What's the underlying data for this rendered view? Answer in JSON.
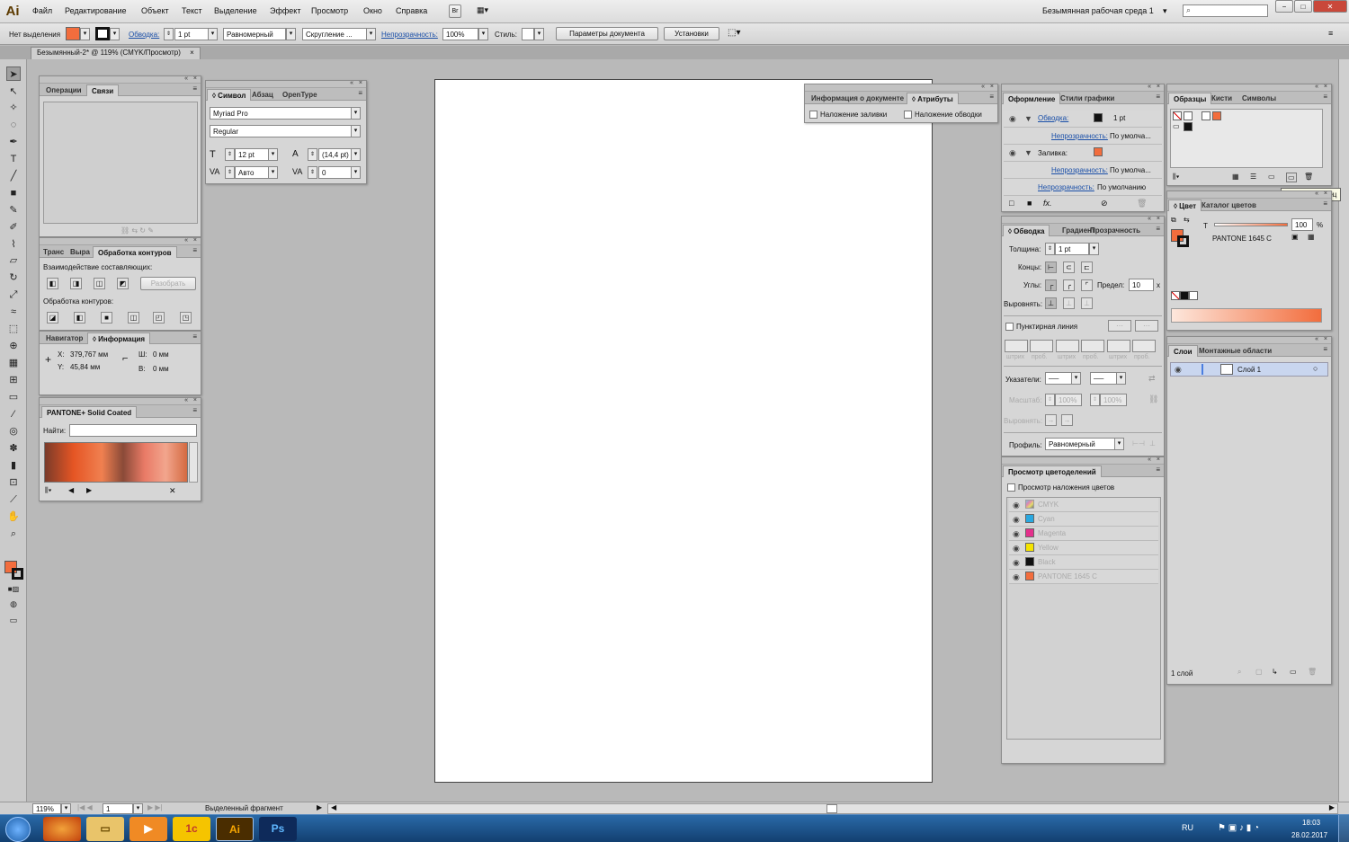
{
  "app": {
    "logo": "Ai",
    "workspace": "Безымянная рабочая среда 1",
    "workspace_arrow": "▾",
    "br": "Br",
    "layout_btn": "▦▾",
    "win_min": "−",
    "win_max": "□",
    "win_close": "✕"
  },
  "menu": [
    "Файл",
    "Редактирование",
    "Объект",
    "Текст",
    "Выделение",
    "Эффект",
    "Просмотр",
    "Окно",
    "Справка"
  ],
  "control": {
    "no_selection": "Нет выделения",
    "stroke_link": "Обводка:",
    "stroke_weight": "1 pt",
    "profile": "Равномерный",
    "brush": "Скругление ...",
    "opacity_link": "Непрозрачность:",
    "opacity": "100%",
    "style_label": "Стиль:",
    "doc_params": "Параметры документа",
    "prefs": "Установки"
  },
  "document_tab": {
    "title": "Безымянный-2* @ 119% (CMYK/Просмотр)",
    "close": "×"
  },
  "panels": {
    "links": {
      "tabs": [
        "Операции",
        "Связи"
      ]
    },
    "pathfinder": {
      "tabs": [
        "Транс",
        "Выра",
        "Обработка контуров"
      ],
      "shape_modes": "Взаимодействие составляющих:",
      "expand": "Разобрать",
      "pathfinders": "Обработка контуров:"
    },
    "info": {
      "tabs": [
        "Навигатор",
        "◊ Информация"
      ],
      "x_label": "X:",
      "x": "379,767 мм",
      "y_label": "Y:",
      "y": "45,84 мм",
      "w_label": "Ш:",
      "w": "0 мм",
      "h_label": "В:",
      "h": "0 мм"
    },
    "pantone": {
      "tab": "PANTONE+ Solid Coated",
      "find_label": "Найти:"
    },
    "character": {
      "tabs": [
        "◊ Символ",
        "Абзац",
        "OpenType"
      ],
      "font": "Myriad Pro",
      "style": "Regular",
      "size": "12 pt",
      "leading": "(14,4 pt)",
      "kerning": "Авто",
      "tracking": "0"
    },
    "docinfo": {
      "tabs": [
        "Информация о документе",
        "◊ Атрибуты"
      ],
      "overprint_fill": "Наложение заливки",
      "overprint_stroke": "Наложение обводки"
    },
    "appearance": {
      "tabs": [
        "Оформление",
        "Стили графики"
      ],
      "stroke_link": "Обводка:",
      "stroke_value": "1 pt",
      "opacity_link": "Непрозрачность:",
      "opacity_value": "По умолча...",
      "fill_label": "Заливка:",
      "opacity_link2": "Непрозрачность:",
      "opacity_value2": "По умолча...",
      "opacity_link3": "Непрозрачность:",
      "opacity_value3": "По умолчанию",
      "fx": "fx."
    },
    "stroke": {
      "tabs": [
        "◊ Обводка",
        "Градиент",
        "Прозрачность"
      ],
      "weight_label": "Толщина:",
      "weight": "1 pt",
      "cap_label": "Концы:",
      "corner_label": "Углы:",
      "limit_label": "Предел:",
      "limit": "10",
      "limit_unit": "x",
      "align_label": "Выровнять:",
      "dashed": "Пунктирная линия",
      "dash_labels": [
        "штрих",
        "проб.",
        "штрих",
        "проб.",
        "штрих",
        "проб."
      ],
      "arrows_label": "Указатели:",
      "scale_label": "Масштаб:",
      "scale1": "100%",
      "scale2": "100%",
      "align2_label": "Выровнять:",
      "profile_label": "Профиль:",
      "profile": "Равномерный"
    },
    "separations": {
      "tab": "Просмотр цветоделений",
      "overprint": "Просмотр наложения цветов",
      "inks": [
        "CMYK",
        "Cyan",
        "Magenta",
        "Yellow",
        "Black",
        "PANTONE 1645 C"
      ]
    },
    "swatches": {
      "tabs": [
        "Образцы",
        "Кисти",
        "Символы"
      ],
      "tooltip": "Новый образец"
    },
    "color": {
      "tabs": [
        "◊ Цвет",
        "Каталог цветов"
      ],
      "t_label": "T",
      "tint": "100",
      "tint_unit": "%",
      "name": "PANTONE 1645 C"
    },
    "layers": {
      "tabs": [
        "Слои",
        "Монтажные области"
      ],
      "layer": "Слой 1",
      "count": "1 слой"
    }
  },
  "status": {
    "zoom": "119%",
    "page": "1",
    "selection": "Выделенный фрагмент"
  },
  "taskbar": {
    "lang": "RU",
    "time": "18:03",
    "date": "28.02.2017",
    "ai": "Ai",
    "ps": "Ps",
    "onec": "1c"
  },
  "colors": {
    "accent": "#f26d3d",
    "ai_dark": "#4a2d00",
    "ps_blue": "#0e2a5a"
  }
}
